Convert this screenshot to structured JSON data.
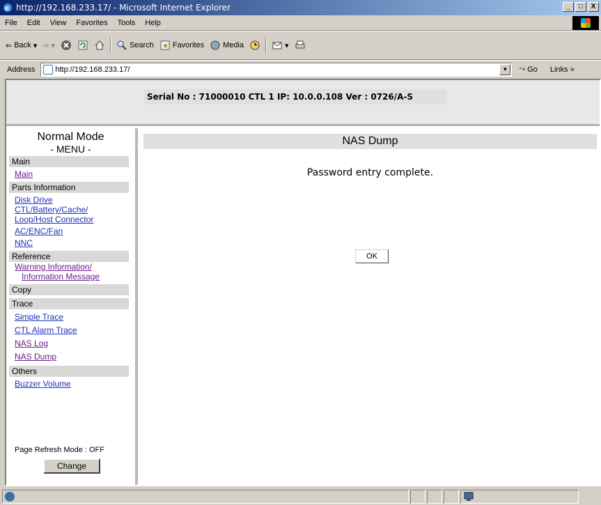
{
  "window": {
    "title": "http://192.168.233.17/ - Microsoft Internet Explorer",
    "buttons": [
      "_",
      "□",
      "X"
    ]
  },
  "menubar": [
    "File",
    "Edit",
    "View",
    "Favorites",
    "Tools",
    "Help"
  ],
  "toolbar": {
    "back": "Back",
    "search": "Search",
    "favorites": "Favorites",
    "media": "Media"
  },
  "address": {
    "label": "Address",
    "url": "http://192.168.233.17/",
    "go": "Go",
    "links": "Links"
  },
  "header": {
    "serial_info": "Serial No : 71000010  CTL 1  IP: 10.0.0.108  Ver : 0726/A-S"
  },
  "sidebar": {
    "mode": "Normal Mode",
    "menu_label": "- MENU -",
    "sections": [
      {
        "title": "Main",
        "links": [
          "Main"
        ]
      },
      {
        "title": "Parts Information",
        "links": [
          "Disk Drive",
          "CTL/Battery/Cache/",
          "Loop/Host Connector",
          "AC/ENC/Fan",
          "NNC"
        ]
      },
      {
        "title": "Reference",
        "links": [
          "Warning Information/",
          "Information Message"
        ]
      },
      {
        "title": "Copy",
        "links": []
      },
      {
        "title": "Trace",
        "links": [
          "Simple Trace",
          "CTL Alarm Trace",
          "NAS Log",
          "NAS Dump"
        ]
      },
      {
        "title": "Others",
        "links": [
          "Buzzer Volume"
        ]
      }
    ],
    "refresh_mode": "Page Refresh Mode : OFF",
    "change_button": "Change"
  },
  "main": {
    "title": "NAS Dump",
    "message": "Password entry complete.",
    "ok_button": "OK"
  },
  "colors": {
    "link": "#1e2fb8",
    "visited": "#6a1a8a",
    "section_bg": "#d8d8d8",
    "title_bar": "#0a246a"
  }
}
